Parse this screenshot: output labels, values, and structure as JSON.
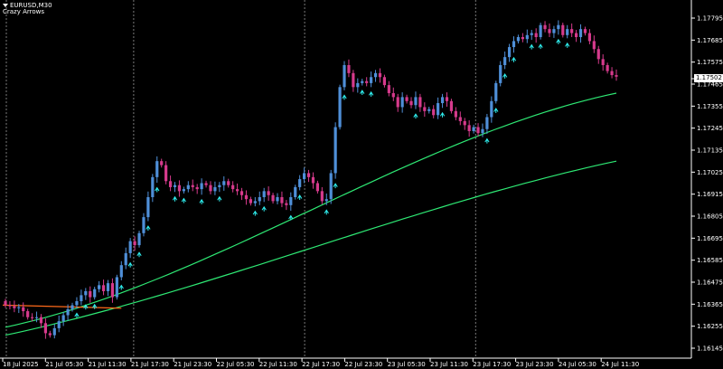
{
  "header": {
    "symbol": "EURUSD,M30",
    "indicator": "Crazy Arrows"
  },
  "price_tag": "1.17502",
  "colors": {
    "background": "#000000",
    "axis": "#ffffff",
    "grid_vline": "#7a7a7a",
    "bull_candle": "#4f8fd8",
    "bear_candle": "#d63a8c",
    "ma_fast": "#2ee874",
    "ma_slow": "#2ee874",
    "ma_early": "#ff6a1a",
    "arrow_up": "#2ff0f0"
  },
  "chart_data": {
    "type": "candlestick",
    "title": "EURUSD,M30",
    "xlabel": "",
    "ylabel": "",
    "y_ticks": [
      "1.17795",
      "1.17685",
      "1.17575",
      "1.17465",
      "1.17355",
      "1.17245",
      "1.17135",
      "1.17025",
      "1.16915",
      "1.16805",
      "1.16695",
      "1.16585",
      "1.16475",
      "1.16365",
      "1.16255",
      "1.16145"
    ],
    "ylim": [
      1.16145,
      1.17795
    ],
    "x_ticks": [
      "18 Jul 2025",
      "21 Jul 05:30",
      "21 Jul 11:30",
      "21 Jul 17:30",
      "21 Jul 23:30",
      "22 Jul 05:30",
      "22 Jul 11:30",
      "22 Jul 17:30",
      "22 Jul 23:30",
      "23 Jul 05:30",
      "23 Jul 11:30",
      "23 Jul 17:30",
      "23 Jul 23:30",
      "24 Jul 05:30",
      "24 Jul 11:30"
    ],
    "day_separators_after_tick": [
      "18 Jul 2025",
      "21 Jul 17:30",
      "22 Jul 17:30",
      "23 Jul 17:30"
    ],
    "candle_closes": [
      1.1636,
      1.16355,
      1.16345,
      1.1635,
      1.1633,
      1.163,
      1.16295,
      1.163,
      1.1627,
      1.1622,
      1.1621,
      1.16245,
      1.1628,
      1.1631,
      1.1634,
      1.1636,
      1.1638,
      1.1641,
      1.1643,
      1.164,
      1.1644,
      1.1646,
      1.1643,
      1.1647,
      1.164,
      1.165,
      1.1656,
      1.1662,
      1.1668,
      1.1666,
      1.1672,
      1.168,
      1.169,
      1.17,
      1.1708,
      1.1706,
      1.1698,
      1.1695,
      1.1696,
      1.1693,
      1.1694,
      1.1696,
      1.1695,
      1.1694,
      1.1697,
      1.1696,
      1.1693,
      1.1695,
      1.1696,
      1.1698,
      1.1696,
      1.1694,
      1.1693,
      1.1691,
      1.1689,
      1.1687,
      1.1688,
      1.169,
      1.1693,
      1.1691,
      1.1688,
      1.169,
      1.1687,
      1.1686,
      1.169,
      1.1695,
      1.1699,
      1.1702,
      1.17,
      1.1697,
      1.1693,
      1.1688,
      1.1689,
      1.1702,
      1.1725,
      1.1745,
      1.1756,
      1.1752,
      1.1745,
      1.1747,
      1.1748,
      1.1747,
      1.175,
      1.1752,
      1.175,
      1.1746,
      1.1742,
      1.174,
      1.1735,
      1.174,
      1.1738,
      1.1736,
      1.174,
      1.1735,
      1.1733,
      1.1734,
      1.1731,
      1.1737,
      1.174,
      1.1738,
      1.1733,
      1.173,
      1.1728,
      1.1726,
      1.1723,
      1.1725,
      1.1722,
      1.1724,
      1.173,
      1.1738,
      1.1747,
      1.1756,
      1.176,
      1.1765,
      1.1768,
      1.177,
      1.1769,
      1.1771,
      1.1772,
      1.177,
      1.1776,
      1.1774,
      1.1772,
      1.1774,
      1.1776,
      1.1771,
      1.1774,
      1.1772,
      1.177,
      1.1774,
      1.1772,
      1.1768,
      1.1764,
      1.1759,
      1.1756,
      1.1753,
      1.1751,
      1.17502
    ],
    "ma_fast": {
      "start_price": 1.1625,
      "end_price": 1.1742
    },
    "ma_slow": {
      "start_price": 1.1621,
      "end_price": 1.1708
    },
    "ma_early": {
      "start_price": 1.1636,
      "end_price": 1.16345
    }
  }
}
